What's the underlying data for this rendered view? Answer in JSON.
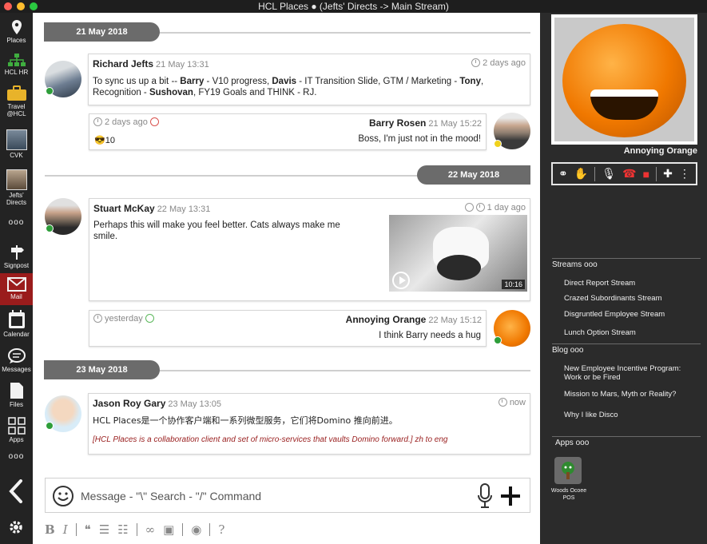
{
  "window": {
    "title": "HCL Places ● (Jefts' Directs -> Main Stream)"
  },
  "sidebar": {
    "items": [
      {
        "label": "Places",
        "icon": "location-pin-icon"
      },
      {
        "label": "HCL HR",
        "icon": "org-chart-icon"
      },
      {
        "label": "Travel @HCL",
        "icon": "suitcase-icon"
      },
      {
        "label": "CVK",
        "icon": "user-avatar-icon"
      },
      {
        "label": "Jefts' Directs",
        "icon": "user-avatar-icon"
      },
      {
        "label": "Signpost",
        "icon": "signpost-icon"
      },
      {
        "label": "Mail",
        "icon": "mail-icon"
      },
      {
        "label": "Calendar",
        "icon": "calendar-icon"
      },
      {
        "label": "Messages",
        "icon": "chat-bubble-icon"
      },
      {
        "label": "Files",
        "icon": "file-icon"
      },
      {
        "label": "Apps",
        "icon": "apps-grid-icon"
      }
    ],
    "more": "ooo"
  },
  "stream": {
    "dates": [
      "21 May 2018",
      "22 May 2018",
      "23 May 2018"
    ],
    "posts": [
      {
        "author": "Richard Jefts",
        "stamp": "21 May 13:31",
        "ago": "2 days ago",
        "text_parts": [
          "To sync us up a bit -- ",
          "Barry",
          " - V10 progress, ",
          "Davis",
          " - IT Transition Slide, GTM / Marketing - ",
          "Tony",
          ",",
          "Recognition - ",
          "Sushovan",
          ", FY19 Goals and THINK - RJ."
        ],
        "reply": {
          "author": "Barry Rosen",
          "stamp": "21 May 15:22",
          "ago": "2 days ago",
          "text": "Boss, I'm just not in the mood!",
          "reaction": "😎10"
        }
      },
      {
        "author": "Stuart McKay",
        "stamp": "22 May 13:31",
        "ago": "1 day ago",
        "text": "Perhaps this will make you feel better. Cats always make me smile.",
        "video_duration": "10:16",
        "reply": {
          "author": "Annoying Orange",
          "stamp": "22 May 15:12",
          "ago": "yesterday",
          "text": "I think Barry needs a hug"
        }
      },
      {
        "author": "Jason Roy Gary",
        "stamp": "23 May 13:05",
        "ago": "now",
        "text": "HCL Places是一个协作客户端和一系列微型服务，它们将Domino 推向前进。",
        "translation": "[HCL Places is a collaboration client and set of micro-services that vaults Domino forward.]  zh to eng"
      }
    ]
  },
  "composer": {
    "placeholder": "Message - \"\\\" Search - \"/\" Command"
  },
  "toolbar": {
    "bold": "B",
    "italic": "I"
  },
  "call": {
    "caller": "Annoying Orange"
  },
  "right": {
    "streams_header": "Streams ooo",
    "streams": [
      "Direct Report Stream",
      "Crazed Subordinants Stream",
      "Disgruntled Employee Stream",
      "Lunch Option Stream"
    ],
    "blog_header": "Blog ooo",
    "blog": [
      "New Employee Incentive Program: Work or be Fired",
      "Mission to Mars, Myth or Reality?",
      "Why I like Disco"
    ],
    "apps_header": "Apps ooo",
    "app_label": "Woods Ocoee POS"
  },
  "colors": {
    "accent_mail": "#9a1c1c",
    "presence_green": "#2e9e3a",
    "presence_yellow": "#f0d21c",
    "pill": "#6b6b6b"
  }
}
